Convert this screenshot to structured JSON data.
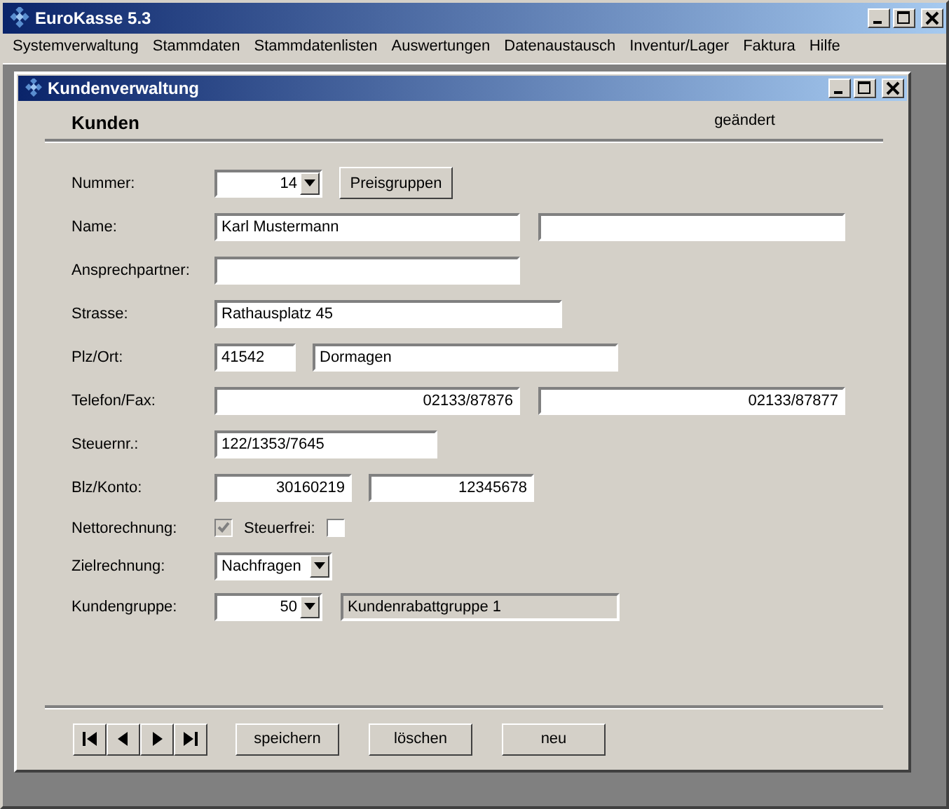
{
  "window": {
    "title": "EuroKasse 5.3"
  },
  "menu": [
    "Systemverwaltung",
    "Stammdaten",
    "Stammdatenlisten",
    "Auswertungen",
    "Datenaustausch",
    "Inventur/Lager",
    "Faktura",
    "Hilfe"
  ],
  "child_window": {
    "title": "Kundenverwaltung",
    "heading": "Kunden",
    "status": "geändert",
    "rows": [
      {
        "label": "Nummer:",
        "controls": [
          {
            "kind": "combo",
            "value": "14"
          },
          {
            "kind": "button",
            "label": "Preisgruppen"
          }
        ]
      },
      {
        "label": "Name:",
        "controls": [
          {
            "kind": "text",
            "value": "Karl Mustermann"
          },
          {
            "kind": "text"
          }
        ]
      },
      {
        "label": "Ansprechpartner:",
        "controls": [
          {
            "kind": "text"
          }
        ]
      },
      {
        "label": "Strasse:",
        "controls": [
          {
            "kind": "text",
            "value": "Rathausplatz 45"
          }
        ]
      },
      {
        "label": "Plz/Ort:",
        "controls": [
          {
            "kind": "text",
            "value": "41542"
          },
          {
            "kind": "text",
            "value": "Dormagen"
          }
        ]
      },
      {
        "label": "Telefon/Fax:",
        "controls": [
          {
            "kind": "text",
            "value": "02133/87876"
          },
          {
            "kind": "text",
            "value": "02133/87877"
          }
        ]
      },
      {
        "label": "Steuernr.:",
        "controls": [
          {
            "kind": "text",
            "value": "122/1353/7645"
          }
        ]
      },
      {
        "label": "Blz/Konto:",
        "controls": [
          {
            "kind": "text",
            "value": "30160219"
          },
          {
            "kind": "text",
            "value": "12345678"
          }
        ]
      },
      {
        "label": "Nettorechnung:",
        "controls": [
          {
            "kind": "checkbox",
            "checked": true,
            "disabled": true
          },
          {
            "kind": "label",
            "label": "Steuerfrei:"
          },
          {
            "kind": "checkbox",
            "checked": false,
            "disabled": false
          }
        ]
      },
      {
        "label": "Zielrechnung:",
        "controls": [
          {
            "kind": "combo",
            "value": "Nachfragen"
          }
        ]
      },
      {
        "label": "Kundengruppe:",
        "controls": [
          {
            "kind": "combo",
            "value": "50"
          },
          {
            "kind": "readonly",
            "value": "Kundenrabattgruppe 1"
          }
        ]
      }
    ],
    "nav_buttons": [
      {
        "kind": "first"
      },
      {
        "kind": "prev"
      },
      {
        "kind": "next"
      },
      {
        "kind": "last"
      }
    ],
    "buttons": [
      "speichern",
      "löschen",
      "neu"
    ]
  }
}
